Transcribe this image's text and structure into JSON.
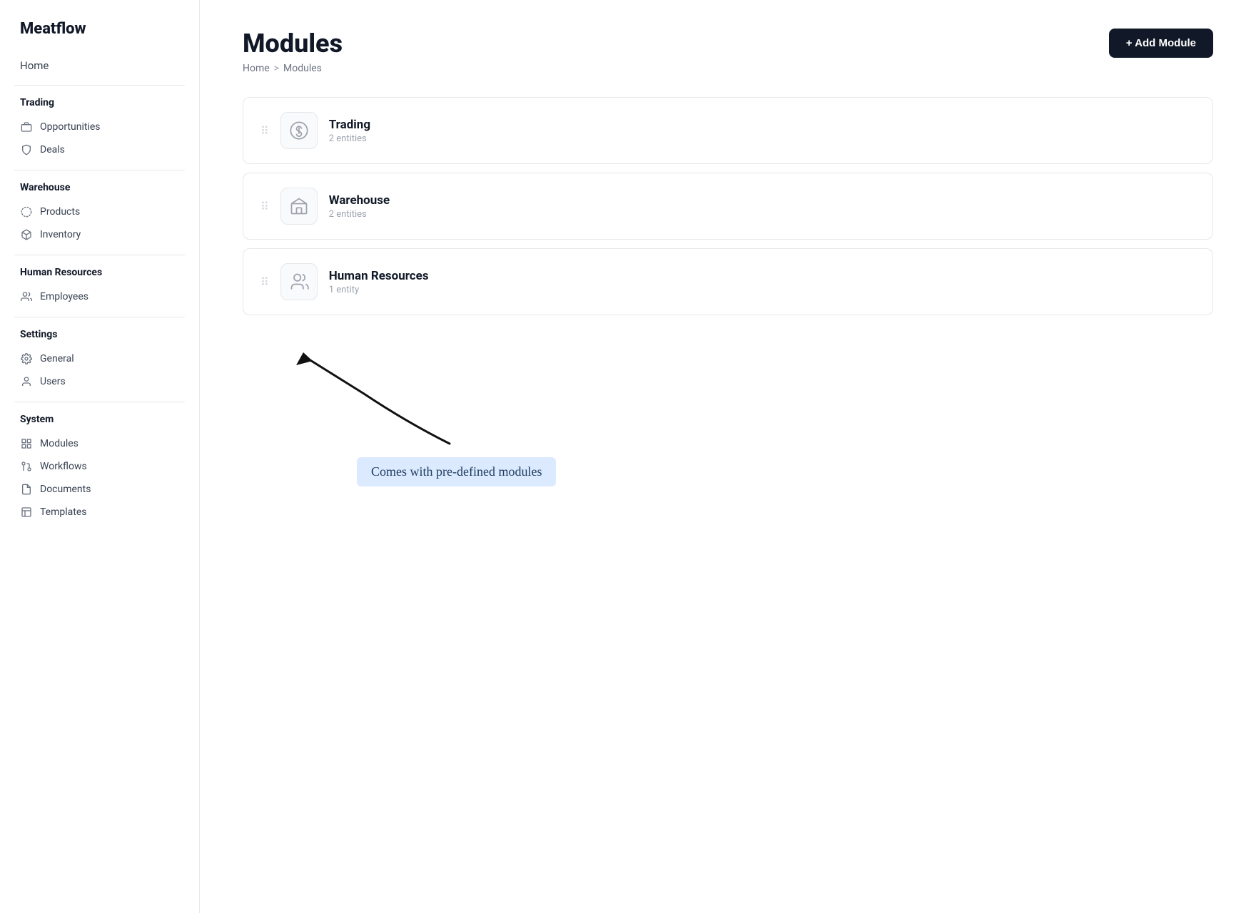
{
  "app": {
    "name": "Meatflow"
  },
  "sidebar": {
    "home_label": "Home",
    "sections": [
      {
        "title": "Trading",
        "items": [
          {
            "id": "opportunities",
            "label": "Opportunities",
            "icon": "briefcase"
          },
          {
            "id": "deals",
            "label": "Deals",
            "icon": "shield"
          }
        ]
      },
      {
        "title": "Warehouse",
        "items": [
          {
            "id": "products",
            "label": "Products",
            "icon": "circle-dashed"
          },
          {
            "id": "inventory",
            "label": "Inventory",
            "icon": "package"
          }
        ]
      },
      {
        "title": "Human Resources",
        "items": [
          {
            "id": "employees",
            "label": "Employees",
            "icon": "users"
          }
        ]
      },
      {
        "title": "Settings",
        "items": [
          {
            "id": "general",
            "label": "General",
            "icon": "gear"
          },
          {
            "id": "users",
            "label": "Users",
            "icon": "user-settings"
          }
        ]
      },
      {
        "title": "System",
        "items": [
          {
            "id": "modules",
            "label": "Modules",
            "icon": "grid"
          },
          {
            "id": "workflows",
            "label": "Workflows",
            "icon": "workflow"
          },
          {
            "id": "documents",
            "label": "Documents",
            "icon": "file"
          },
          {
            "id": "templates",
            "label": "Templates",
            "icon": "template"
          }
        ]
      }
    ]
  },
  "main": {
    "page_title": "Modules",
    "breadcrumb": {
      "home": "Home",
      "separator": ">",
      "current": "Modules"
    },
    "add_button_label": "+ Add Module",
    "modules": [
      {
        "id": "trading",
        "name": "Trading",
        "entities": "2 entities",
        "icon": "dollar-circle"
      },
      {
        "id": "warehouse",
        "name": "Warehouse",
        "entities": "2 entities",
        "icon": "warehouse"
      },
      {
        "id": "human-resources",
        "name": "Human Resources",
        "entities": "1 entity",
        "icon": "people"
      }
    ]
  },
  "annotation": {
    "text": "Comes with pre-defined modules"
  }
}
